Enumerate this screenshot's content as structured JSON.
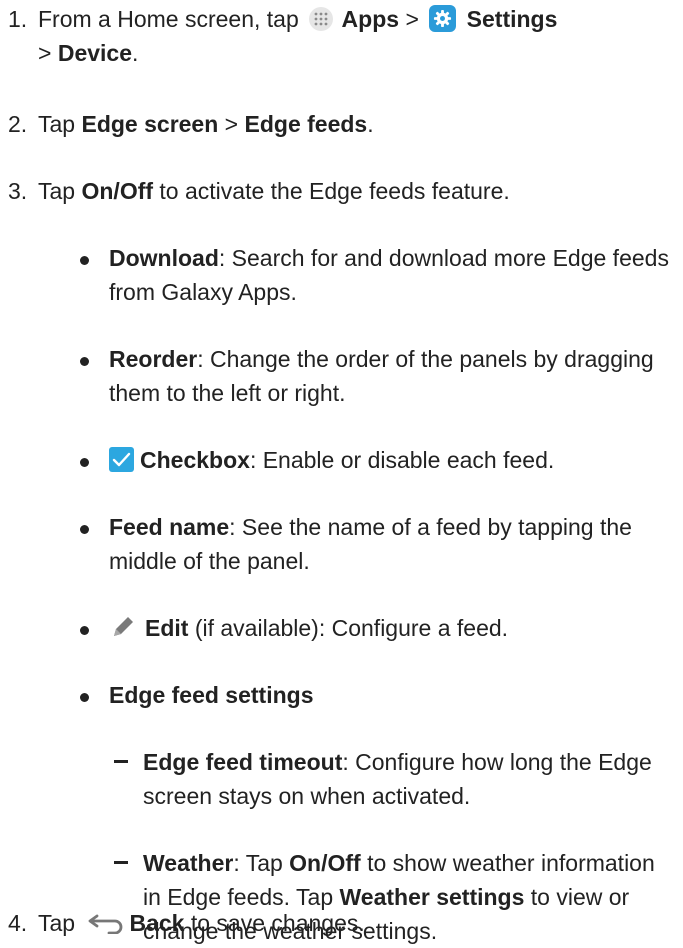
{
  "steps": [
    {
      "num": "1.",
      "pre": "From a Home screen, tap",
      "apps": "Apps",
      "gt1": ">",
      "settings": "Settings",
      "gt2": ">",
      "device": "Device",
      "end": "."
    },
    {
      "num": "2.",
      "pre": "Tap",
      "b1": "Edge screen",
      "gt": ">",
      "b2": "Edge feeds",
      "end": "."
    },
    {
      "num": "3.",
      "pre": "Tap",
      "b1": "On/Off",
      "post": "to activate the Edge feeds feature."
    },
    {
      "num": "4.",
      "pre": "Tap",
      "b1": "Back",
      "post": "to save changes."
    }
  ],
  "bullets": {
    "download": {
      "title": "Download",
      "desc": ": Search for and download more Edge feeds from Galaxy Apps."
    },
    "reorder": {
      "title": "Reorder",
      "desc": ": Change the order of the panels by dragging them to the left or right."
    },
    "checkbox": {
      "title": "Checkbox",
      "desc": ": Enable or disable each feed."
    },
    "feedname": {
      "title": "Feed name",
      "desc": ": See the name of a feed by tapping the middle of the panel."
    },
    "edit": {
      "title": "Edit",
      "desc": " (if available): Configure a feed."
    },
    "settings": {
      "title": "Edge feed settings"
    }
  },
  "subs": {
    "timeout": {
      "title": "Edge feed timeout",
      "desc": ": Configure how long the Edge screen stays on when activated."
    },
    "weather": {
      "title": "Weather",
      "d1": ": Tap",
      "b1": "On/Off",
      "d2": "to show weather information in Edge feeds. Tap",
      "b2": "Weather settings",
      "d3": "to view or change the weather settings."
    }
  },
  "icons": {
    "apps": "apps-grid-icon",
    "settings": "settings-gear-icon",
    "checkbox": "checkbox-checked-icon",
    "edit": "pencil-edit-icon",
    "back": "back-arrow-icon"
  },
  "colors": {
    "settings_icon": "#2b9bd9",
    "checkbox_icon": "#2ca7e0",
    "apps_icon_bg": "#e6e6e6",
    "text": "#222222"
  }
}
